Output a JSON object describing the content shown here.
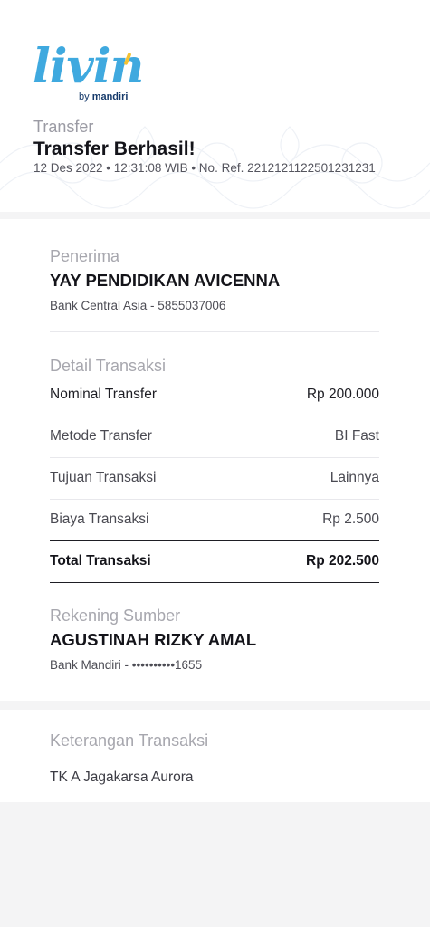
{
  "brand": {
    "logo_word": "livin",
    "logo_by": "by",
    "logo_sub": "mandiri"
  },
  "header": {
    "kicker": "Transfer",
    "title": "Transfer Berhasil!",
    "meta": "12 Des 2022 • 12:31:08 WIB • No. Ref. 2212121122501231231"
  },
  "recipient": {
    "section_label": "Penerima",
    "name": "YAY PENDIDIKAN AVICENNA",
    "bank_account": "Bank Central Asia - 5855037006"
  },
  "details": {
    "section_label": "Detail Transaksi",
    "rows": [
      {
        "label": "Nominal Transfer",
        "value": "Rp 200.000"
      },
      {
        "label": "Metode Transfer",
        "value": "BI Fast"
      },
      {
        "label": "Tujuan Transaksi",
        "value": "Lainnya"
      },
      {
        "label": "Biaya Transaksi",
        "value": "Rp 2.500"
      }
    ],
    "total": {
      "label": "Total Transaksi",
      "value": "Rp 202.500"
    }
  },
  "source": {
    "section_label": "Rekening Sumber",
    "name": "AGUSTINAH RIZKY AMAL",
    "bank_account": "Bank Mandiri - ••••••••••1655"
  },
  "notes": {
    "section_label": "Keterangan Transaksi",
    "text": "TK A Jagakarsa Aurora"
  },
  "colors": {
    "brand_blue": "#3fa9df",
    "brand_yellow": "#f5c232",
    "brand_navy": "#163a6b",
    "page_bg": "#f4f4f5"
  },
  "icons": {
    "logo": "livin-mandiri-logo"
  }
}
